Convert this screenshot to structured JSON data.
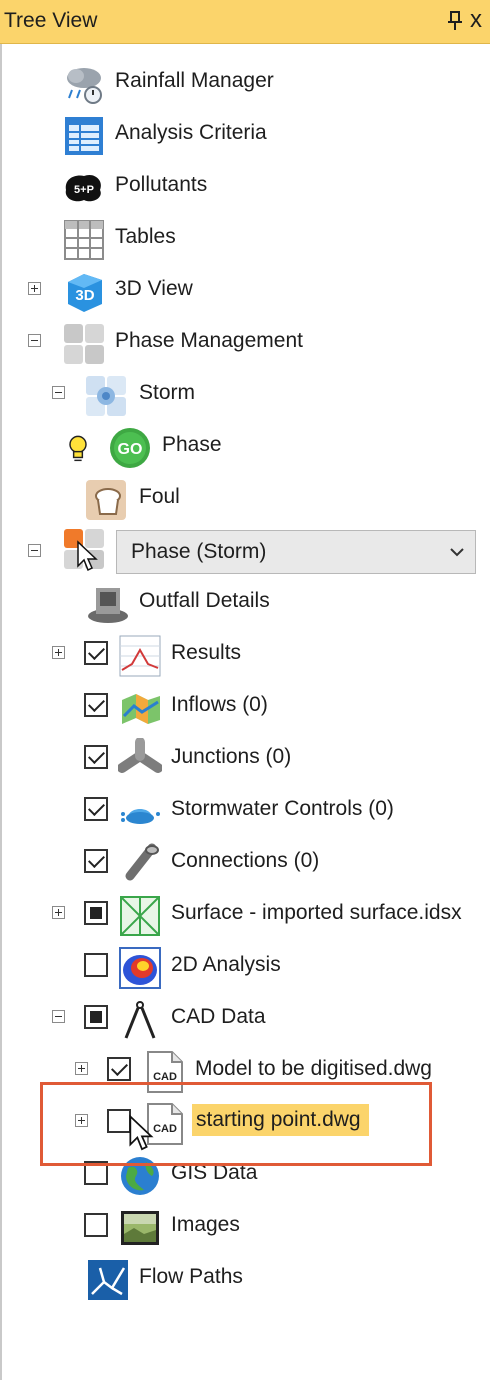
{
  "panel": {
    "title": "Tree View",
    "pin_icon": "pin-icon",
    "close_label": "x"
  },
  "tree": {
    "rainfall_manager": "Rainfall Manager",
    "analysis_criteria": "Analysis Criteria",
    "pollutants": "Pollutants",
    "tables": "Tables",
    "view_3d": "3D View",
    "phase_management": "Phase Management",
    "storm": "Storm",
    "phase": "Phase",
    "foul": "Foul",
    "phase_select_value": "Phase (Storm)",
    "outfall_details": "Outfall Details",
    "results": "Results",
    "inflows": "Inflows (0)",
    "junctions": "Junctions (0)",
    "stormwater_controls": "Stormwater Controls (0)",
    "connections": "Connections (0)",
    "surface": "Surface - imported surface.idsx",
    "analysis_2d": "2D Analysis",
    "cad_data": "CAD Data",
    "cad_badge": "CAD",
    "model_dwg": "Model to be digitised.dwg",
    "starting_point": "starting point.dwg",
    "gis_data": "GIS Data",
    "images": "Images",
    "flow_paths": "Flow Paths",
    "go_badge": "GO",
    "view_3d_badge": "3D",
    "pollutant_badge": "5+P"
  },
  "colors": {
    "title_bar": "#fbd46b",
    "selection_highlight": "#fbd46b",
    "annotation_box": "#e05a36"
  }
}
